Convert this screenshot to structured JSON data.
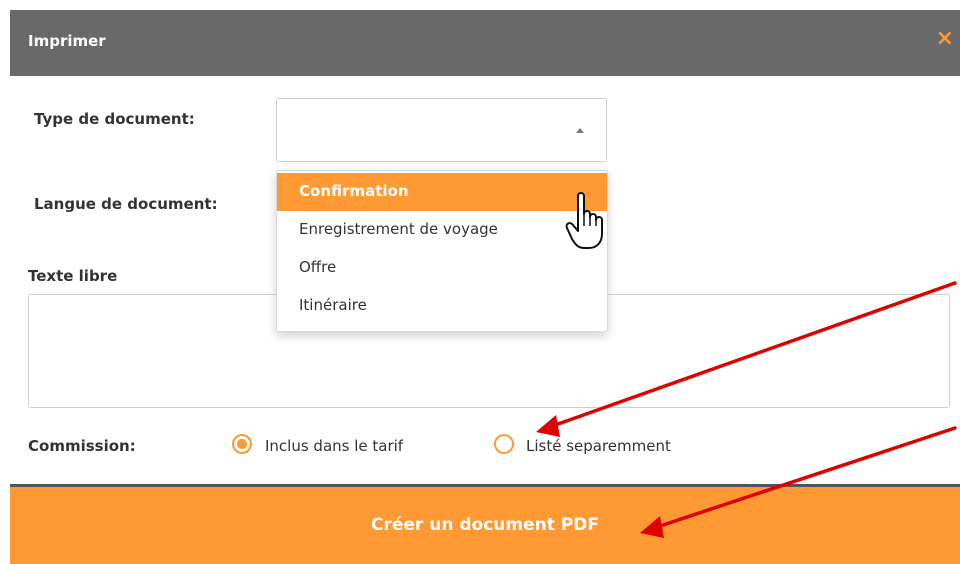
{
  "dialog": {
    "title": "Imprimer",
    "close_icon": "close-icon",
    "close_glyph": "×"
  },
  "form": {
    "doc_type_label": "Type de document:",
    "doc_lang_label": "Langue de document:",
    "free_text_label": "Texte libre",
    "commission_label": "Commission:"
  },
  "doc_type_dropdown": {
    "selected_value": "",
    "options": [
      "Confirmation",
      "Enregistrement de voyage",
      "Offre",
      "Itinéraire"
    ],
    "highlighted": "Confirmation"
  },
  "commission": {
    "options": [
      "Inclus dans le tarif",
      "Listé separemment"
    ],
    "selected": "Inclus dans le tarif"
  },
  "actions": {
    "create_pdf_label": "Créer un document PDF"
  },
  "colors": {
    "header_bg": "#696969",
    "accent": "#ff9933",
    "annotation_arrow": "#e00000"
  }
}
